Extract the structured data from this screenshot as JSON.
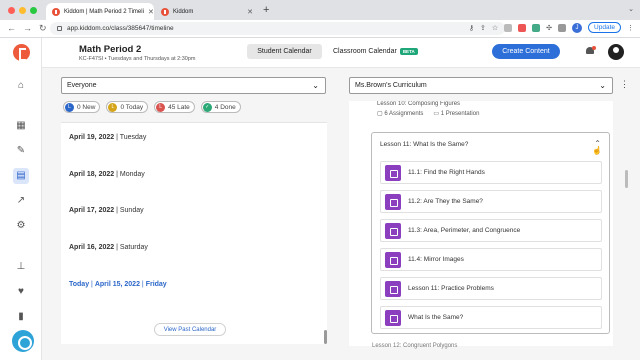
{
  "browser": {
    "tabs": [
      {
        "title": "Kiddom | Math Period 2 Timeli"
      },
      {
        "title": "Kiddom"
      }
    ],
    "url": "app.kiddom.co/class/385647/timeline",
    "update_label": "Update",
    "profile_initial": "J"
  },
  "header": {
    "class_title": "Math Period 2",
    "class_sub": "KC-F47SI • Tuesdays and Thursdays at 2:30pm",
    "student_calendar": "Student Calendar",
    "classroom_calendar": "Classroom Calendar",
    "beta": "BETA",
    "create": "Create Content"
  },
  "left": {
    "filter": "Everyone",
    "chips": [
      {
        "count": "0 New",
        "color": "#2b66c9",
        "icon": "L"
      },
      {
        "count": "0 Today",
        "color": "#d6a419",
        "icon": "L"
      },
      {
        "count": "45 Late",
        "color": "#d9534f",
        "icon": "L"
      },
      {
        "count": "4 Done",
        "color": "#2aa876",
        "icon": "✓"
      }
    ],
    "days": [
      {
        "date": "April 19, 2022",
        "dow": "Tuesday"
      },
      {
        "date": "April 18, 2022",
        "dow": "Monday"
      },
      {
        "date": "April 17, 2022",
        "dow": "Sunday"
      },
      {
        "date": "April 16, 2022",
        "dow": "Saturday"
      }
    ],
    "today": {
      "prefix": "Today",
      "date": "April 15, 2022",
      "dow": "Friday"
    },
    "view_past": "View Past Calendar"
  },
  "right": {
    "curriculum": "Ms.Brown's Curriculum",
    "prev_lesson": {
      "title": "Lesson 10: Composing Figures",
      "assignments": "6 Assignments",
      "presentation": "1 Presentation"
    },
    "lesson": {
      "title": "Lesson 11: What Is the Same?",
      "items": [
        "11.1: Find the Right Hands",
        "11.2: Are They the Same?",
        "11.3: Area, Perimeter, and Congruence",
        "11.4: Mirror Images",
        "Lesson 11: Practice Problems",
        "What Is the Same?"
      ]
    },
    "next_lesson": "Lesson 12: Congruent Polygons"
  }
}
